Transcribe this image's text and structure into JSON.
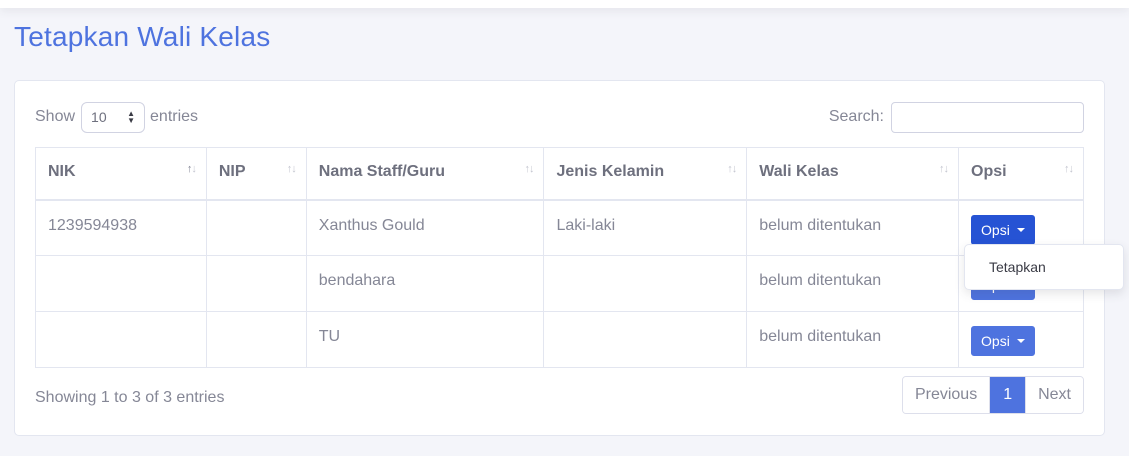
{
  "page": {
    "title": "Tetapkan Wali Kelas"
  },
  "length_control": {
    "show_label": "Show",
    "value": "10",
    "entries_label": "entries"
  },
  "search": {
    "label": "Search:",
    "value": ""
  },
  "table": {
    "columns": [
      "NIK",
      "NIP",
      "Nama Staff/Guru",
      "Jenis Kelamin",
      "Wali Kelas",
      "Opsi"
    ],
    "rows": [
      {
        "nik": "1239594938",
        "nip": "",
        "nama": "Xanthus Gould",
        "jk": "Laki-laki",
        "wali": "belum ditentukan",
        "opsi": "Opsi"
      },
      {
        "nik": "",
        "nip": "",
        "nama": "bendahara",
        "jk": "",
        "wali": "belum ditentukan",
        "opsi": "Opsi"
      },
      {
        "nik": "",
        "nip": "",
        "nama": "TU",
        "jk": "",
        "wali": "belum ditentukan",
        "opsi": "Opsi"
      }
    ]
  },
  "dropdown": {
    "item": "Tetapkan"
  },
  "info": "Showing 1 to 3 of 3 entries",
  "pagination": {
    "previous": "Previous",
    "current": "1",
    "next": "Next"
  },
  "colors": {
    "primary": "#4e73df",
    "primary_active": "#2653d4",
    "text": "#858796"
  }
}
